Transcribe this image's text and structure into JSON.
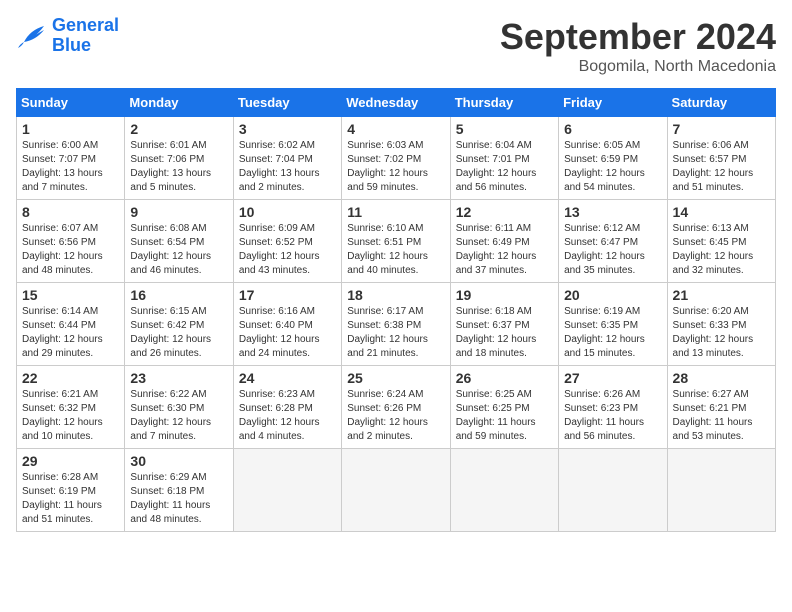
{
  "logo": {
    "line1": "General",
    "line2": "Blue"
  },
  "title": "September 2024",
  "location": "Bogomila, North Macedonia",
  "headers": [
    "Sunday",
    "Monday",
    "Tuesday",
    "Wednesday",
    "Thursday",
    "Friday",
    "Saturday"
  ],
  "weeks": [
    [
      {
        "day": "1",
        "info": "Sunrise: 6:00 AM\nSunset: 7:07 PM\nDaylight: 13 hours\nand 7 minutes."
      },
      {
        "day": "2",
        "info": "Sunrise: 6:01 AM\nSunset: 7:06 PM\nDaylight: 13 hours\nand 5 minutes."
      },
      {
        "day": "3",
        "info": "Sunrise: 6:02 AM\nSunset: 7:04 PM\nDaylight: 13 hours\nand 2 minutes."
      },
      {
        "day": "4",
        "info": "Sunrise: 6:03 AM\nSunset: 7:02 PM\nDaylight: 12 hours\nand 59 minutes."
      },
      {
        "day": "5",
        "info": "Sunrise: 6:04 AM\nSunset: 7:01 PM\nDaylight: 12 hours\nand 56 minutes."
      },
      {
        "day": "6",
        "info": "Sunrise: 6:05 AM\nSunset: 6:59 PM\nDaylight: 12 hours\nand 54 minutes."
      },
      {
        "day": "7",
        "info": "Sunrise: 6:06 AM\nSunset: 6:57 PM\nDaylight: 12 hours\nand 51 minutes."
      }
    ],
    [
      {
        "day": "8",
        "info": "Sunrise: 6:07 AM\nSunset: 6:56 PM\nDaylight: 12 hours\nand 48 minutes."
      },
      {
        "day": "9",
        "info": "Sunrise: 6:08 AM\nSunset: 6:54 PM\nDaylight: 12 hours\nand 46 minutes."
      },
      {
        "day": "10",
        "info": "Sunrise: 6:09 AM\nSunset: 6:52 PM\nDaylight: 12 hours\nand 43 minutes."
      },
      {
        "day": "11",
        "info": "Sunrise: 6:10 AM\nSunset: 6:51 PM\nDaylight: 12 hours\nand 40 minutes."
      },
      {
        "day": "12",
        "info": "Sunrise: 6:11 AM\nSunset: 6:49 PM\nDaylight: 12 hours\nand 37 minutes."
      },
      {
        "day": "13",
        "info": "Sunrise: 6:12 AM\nSunset: 6:47 PM\nDaylight: 12 hours\nand 35 minutes."
      },
      {
        "day": "14",
        "info": "Sunrise: 6:13 AM\nSunset: 6:45 PM\nDaylight: 12 hours\nand 32 minutes."
      }
    ],
    [
      {
        "day": "15",
        "info": "Sunrise: 6:14 AM\nSunset: 6:44 PM\nDaylight: 12 hours\nand 29 minutes."
      },
      {
        "day": "16",
        "info": "Sunrise: 6:15 AM\nSunset: 6:42 PM\nDaylight: 12 hours\nand 26 minutes."
      },
      {
        "day": "17",
        "info": "Sunrise: 6:16 AM\nSunset: 6:40 PM\nDaylight: 12 hours\nand 24 minutes."
      },
      {
        "day": "18",
        "info": "Sunrise: 6:17 AM\nSunset: 6:38 PM\nDaylight: 12 hours\nand 21 minutes."
      },
      {
        "day": "19",
        "info": "Sunrise: 6:18 AM\nSunset: 6:37 PM\nDaylight: 12 hours\nand 18 minutes."
      },
      {
        "day": "20",
        "info": "Sunrise: 6:19 AM\nSunset: 6:35 PM\nDaylight: 12 hours\nand 15 minutes."
      },
      {
        "day": "21",
        "info": "Sunrise: 6:20 AM\nSunset: 6:33 PM\nDaylight: 12 hours\nand 13 minutes."
      }
    ],
    [
      {
        "day": "22",
        "info": "Sunrise: 6:21 AM\nSunset: 6:32 PM\nDaylight: 12 hours\nand 10 minutes."
      },
      {
        "day": "23",
        "info": "Sunrise: 6:22 AM\nSunset: 6:30 PM\nDaylight: 12 hours\nand 7 minutes."
      },
      {
        "day": "24",
        "info": "Sunrise: 6:23 AM\nSunset: 6:28 PM\nDaylight: 12 hours\nand 4 minutes."
      },
      {
        "day": "25",
        "info": "Sunrise: 6:24 AM\nSunset: 6:26 PM\nDaylight: 12 hours\nand 2 minutes."
      },
      {
        "day": "26",
        "info": "Sunrise: 6:25 AM\nSunset: 6:25 PM\nDaylight: 11 hours\nand 59 minutes."
      },
      {
        "day": "27",
        "info": "Sunrise: 6:26 AM\nSunset: 6:23 PM\nDaylight: 11 hours\nand 56 minutes."
      },
      {
        "day": "28",
        "info": "Sunrise: 6:27 AM\nSunset: 6:21 PM\nDaylight: 11 hours\nand 53 minutes."
      }
    ],
    [
      {
        "day": "29",
        "info": "Sunrise: 6:28 AM\nSunset: 6:19 PM\nDaylight: 11 hours\nand 51 minutes."
      },
      {
        "day": "30",
        "info": "Sunrise: 6:29 AM\nSunset: 6:18 PM\nDaylight: 11 hours\nand 48 minutes."
      },
      {
        "day": "",
        "info": ""
      },
      {
        "day": "",
        "info": ""
      },
      {
        "day": "",
        "info": ""
      },
      {
        "day": "",
        "info": ""
      },
      {
        "day": "",
        "info": ""
      }
    ]
  ]
}
